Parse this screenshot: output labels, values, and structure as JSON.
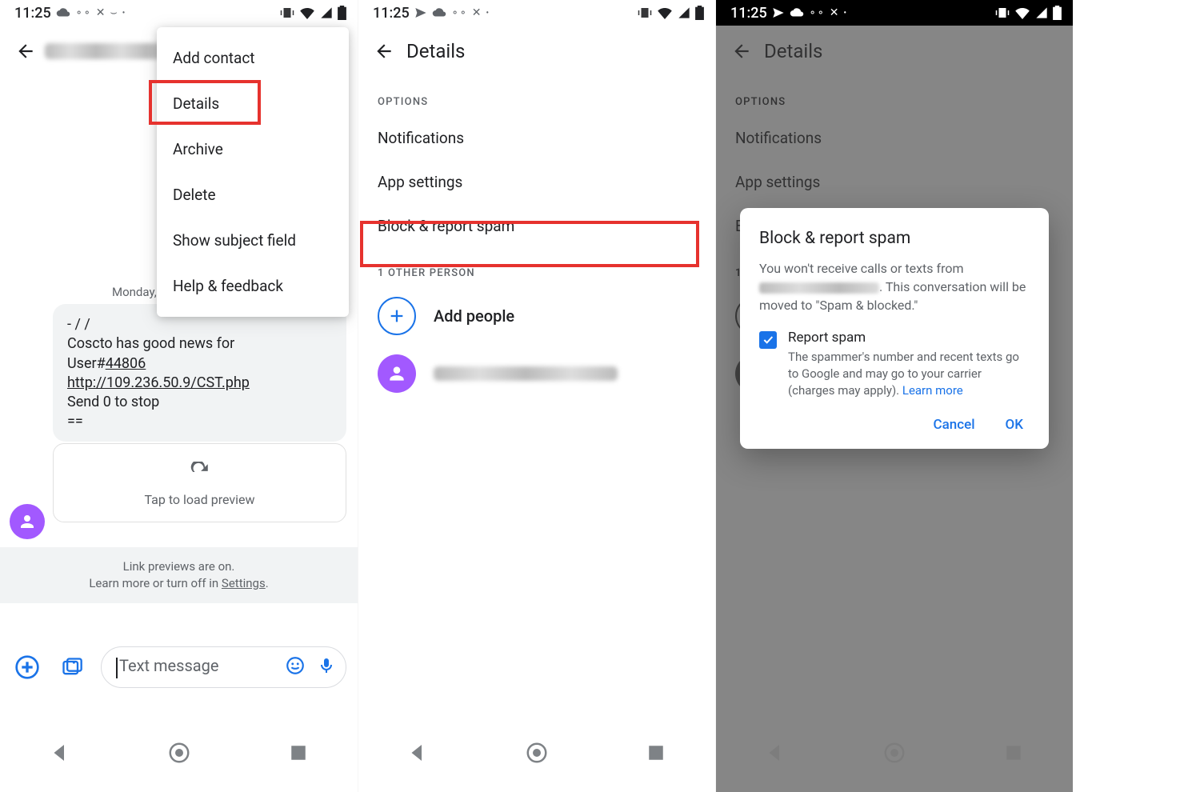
{
  "status_bar": {
    "time": "11:25"
  },
  "screen1": {
    "menu": {
      "add_contact": "Add contact",
      "details": "Details",
      "archive": "Archive",
      "delete": "Delete",
      "show_subject": "Show subject field",
      "help": "Help & feedback"
    },
    "timestamp": "Monday,",
    "message": {
      "line1": "- / /",
      "line2": "Coscto has good news for",
      "line3_prefix": "User#",
      "line3_id": "44806",
      "link": "http://109.236.50.9/CST.php",
      "line5": "Send 0 to stop",
      "line6": "=="
    },
    "preview": {
      "label": "Tap to load preview"
    },
    "link_notice": {
      "line1": "Link previews are on.",
      "line2_prefix": "Learn more or turn off in ",
      "settings": "Settings"
    },
    "compose": {
      "placeholder": "Text message"
    }
  },
  "screen2": {
    "title": "Details",
    "options_header": "OPTIONS",
    "notifications": "Notifications",
    "app_settings": "App settings",
    "block": "Block & report spam",
    "other_header": "1 OTHER PERSON",
    "add_people": "Add people"
  },
  "screen3": {
    "title": "Details",
    "options_header": "OPTIONS",
    "notifications": "Notifications",
    "app_settings": "App settings",
    "block_prefix": "Bl",
    "dialog": {
      "title": "Block & report spam",
      "body_prefix": "You won't receive calls or texts from ",
      "body_suffix": ". This conversation will be moved to \"Spam & blocked.\"",
      "checkbox_label": "Report spam",
      "checkbox_desc_prefix": "The spammer's number and recent texts go to Google and may go to your carrier (charges may apply). ",
      "learn_more": "Learn more",
      "cancel": "Cancel",
      "ok": "OK"
    }
  }
}
